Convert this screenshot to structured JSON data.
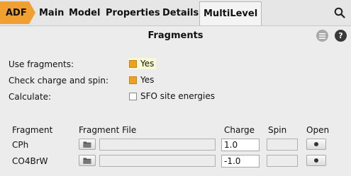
{
  "tabs": {
    "adf": "ADF",
    "items": [
      "Main",
      "Model",
      "Properties",
      "Details",
      "MultiLevel"
    ]
  },
  "panel": {
    "title": "Fragments",
    "menu_icon": "menu-lines-icon",
    "help_label": "?"
  },
  "options": {
    "use_fragments": {
      "label": "Use fragments:",
      "value": "Yes",
      "checked": true
    },
    "check_charge_spin": {
      "label": "Check charge and spin:",
      "value": "Yes",
      "checked": true
    },
    "calculate": {
      "label": "Calculate:",
      "value": "SFO site energies",
      "checked": false
    }
  },
  "table": {
    "headers": {
      "fragment": "Fragment",
      "file": "Fragment File",
      "charge": "Charge",
      "spin": "Spin",
      "open": "Open"
    },
    "rows": [
      {
        "name": "CPh",
        "file": "",
        "charge": "1.0",
        "spin": ""
      },
      {
        "name": "CO4BrW",
        "file": "",
        "charge": "-1.0",
        "spin": ""
      }
    ]
  },
  "colors": {
    "accent": "#f0a030",
    "highlight": "#fafad2"
  }
}
